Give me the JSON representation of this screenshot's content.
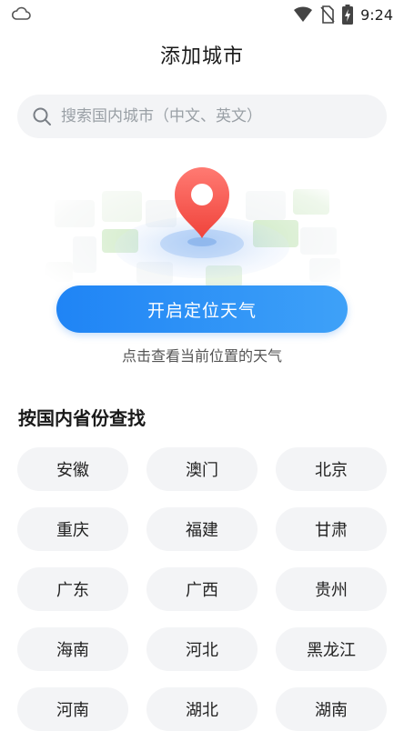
{
  "status_bar": {
    "time": "9:24",
    "icons": [
      "cloud-icon",
      "wifi-icon",
      "no-sim-icon",
      "battery-charging-icon"
    ]
  },
  "header": {
    "title": "添加城市"
  },
  "search": {
    "placeholder": "搜索国内城市（中文、英文）",
    "icon": "search-icon"
  },
  "locate": {
    "button_label": "开启定位天气",
    "hint": "点击查看当前位置的天气",
    "accent": "#1f84f5"
  },
  "provinces": {
    "section_title": "按国内省份查找",
    "items": [
      "安徽",
      "澳门",
      "北京",
      "重庆",
      "福建",
      "甘肃",
      "广东",
      "广西",
      "贵州",
      "海南",
      "河北",
      "黑龙江",
      "河南",
      "湖北",
      "湖南"
    ]
  }
}
